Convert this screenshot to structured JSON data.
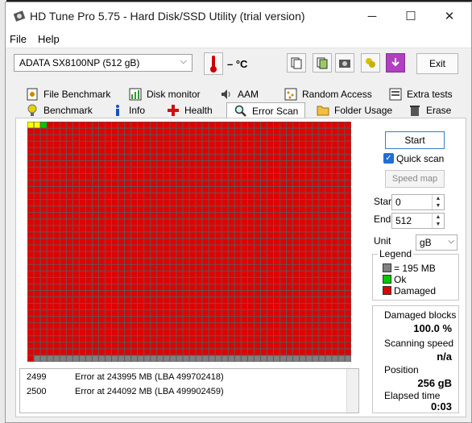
{
  "window": {
    "title": "HD Tune Pro 5.75 - Hard Disk/SSD Utility (trial version)"
  },
  "menu": {
    "file": "File",
    "help": "Help"
  },
  "toolbar": {
    "drive": "ADATA SX8100NP (512 gB)",
    "temperature": "– °C",
    "exit_label": "Exit",
    "buttons": [
      "copy-info-icon",
      "copy-screenshot-icon",
      "camera-icon",
      "tools-icon",
      "download-icon"
    ]
  },
  "tabs": {
    "row1": [
      "File Benchmark",
      "Disk monitor",
      "AAM",
      "Random Access",
      "Extra tests"
    ],
    "row2": [
      "Benchmark",
      "Info",
      "Health",
      "Error Scan",
      "Folder Usage",
      "Erase"
    ],
    "active": "Error Scan"
  },
  "scan": {
    "start_label": "Start",
    "quick_scan_label": "Quick scan",
    "quick_scan_checked": true,
    "speed_map_label": "Speed map",
    "start_field_label": "Start",
    "start_value": "0",
    "end_field_label": "End",
    "end_value": "512",
    "unit_label": "Unit",
    "unit_value": "gB",
    "grid": {
      "columns": 50,
      "rows": 37,
      "total_blocks": 2626,
      "scanned_blocks": 1801,
      "ok_blocks": 3
    }
  },
  "legend": {
    "title": "Legend",
    "block_size": "= 195 MB",
    "ok": "Ok",
    "damaged": "Damaged",
    "colors": {
      "unscanned": "#808080",
      "ok": "#00c800",
      "damaged": "#e00000",
      "yellow": "#ffff00"
    }
  },
  "stats": {
    "damaged_label": "Damaged blocks",
    "damaged_value": "100.0 %",
    "speed_label": "Scanning speed",
    "speed_value": "n/a",
    "position_label": "Position",
    "position_value": "256 gB",
    "elapsed_label": "Elapsed time",
    "elapsed_value": "0:03"
  },
  "log": [
    {
      "num": "2499",
      "text": "Error at 243995 MB (LBA 499702418)"
    },
    {
      "num": "2500",
      "text": "Error at 244092 MB (LBA 499902459)"
    }
  ]
}
